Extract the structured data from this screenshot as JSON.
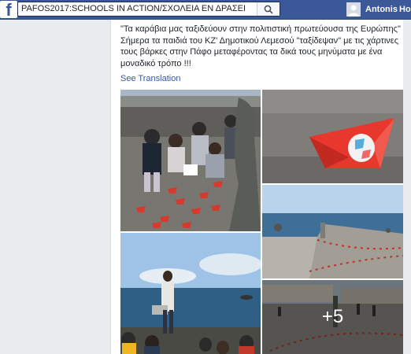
{
  "topbar": {
    "logo": "f",
    "search_value": "PAFOS2017:SCHOOLS IN ACTION/ΣΧΟΛΕΙΑ ΕΝ ΔΡΑΣΕΙ",
    "user_name": "Antonis",
    "home_label": "Ho",
    "icons": [
      "facebook-logo-icon",
      "search-icon",
      "avatar-icon"
    ]
  },
  "post": {
    "text_line1": "\"Τα καράβια μας ταξιδεύουν στην πολιτιστική πρωτεύουσα της Ευρώπης\"",
    "text_line2": "Σήμερα τα παιδιά του ΚΖ' Δημοτικού Λεμεσού \"ταξίδεψαν\" με τις χάρτινες",
    "text_line3": "τους βάρκες στην Πάφο μεταφέροντας τα δικά τους μηνύματα με ένα",
    "text_line4": "μοναδικό τρόπο !!!",
    "see_translation": "See Translation",
    "more_photos": "+5"
  },
  "colors": {
    "topbar": "#3b5998",
    "link": "#365899",
    "paper_boat": "#e8372c"
  }
}
